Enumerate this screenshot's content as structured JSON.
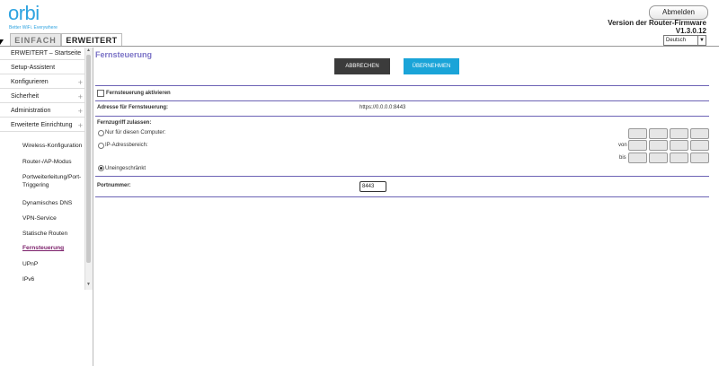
{
  "header": {
    "logo": "orbi",
    "tagline": "Better WiFi. Everywhere",
    "logout_label": "Abmelden",
    "firmware_title": "Version der Router-Firmware",
    "firmware_version": "V1.3.0.12",
    "language": "Deutsch",
    "tabs": [
      {
        "label": "EINFACH",
        "active": false
      },
      {
        "label": "ERWEITERT",
        "active": true
      }
    ]
  },
  "sidebar": {
    "items": [
      {
        "label": "ERWEITERT – Startseite",
        "expandable": false
      },
      {
        "label": "Setup-Assistent",
        "expandable": false
      },
      {
        "label": "Konfigurieren",
        "expandable": true
      },
      {
        "label": "Sicherheit",
        "expandable": true
      },
      {
        "label": "Administration",
        "expandable": true
      },
      {
        "label": "Erweiterte Einrichtung",
        "expandable": true
      }
    ],
    "subitems": [
      {
        "label": "Wireless-Konfiguration"
      },
      {
        "label": "Router-/AP-Modus"
      },
      {
        "label": "Portweiterleitung/Port-Triggering"
      },
      {
        "label": "Dynamisches DNS"
      },
      {
        "label": "VPN-Service"
      },
      {
        "label": "Statische Routen"
      },
      {
        "label": "Fernsteuerung",
        "active": true
      },
      {
        "label": "UPnP"
      },
      {
        "label": "IPv6"
      }
    ],
    "plus_icon": "+"
  },
  "main": {
    "title": "Fernsteuerung",
    "cancel_label": "ABBRECHEN",
    "apply_label": "ÜBERNEHMEN",
    "enable_label": "Fernsteuerung aktivieren",
    "enable_checked": false,
    "address_label": "Adresse für Fernsteuerung:",
    "address_value": "https://0.0.0.0:8443",
    "access_label": "Fernzugriff zulassen:",
    "options": [
      {
        "label": "Nur für diesen Computer:",
        "selected": false
      },
      {
        "label": "IP-Adressbereich:",
        "selected": false
      },
      {
        "label": "Uneingeschränkt",
        "selected": true
      }
    ],
    "range_from": "von",
    "range_to": "bis",
    "port_label": "Portnummer:",
    "port_value": "8443"
  },
  "colors": {
    "accent": "#7a72c6",
    "apply": "#1aa4d8",
    "cancel": "#3b3b3b",
    "brand": "#2ea3e0",
    "active_nav": "#7b1f6a"
  }
}
